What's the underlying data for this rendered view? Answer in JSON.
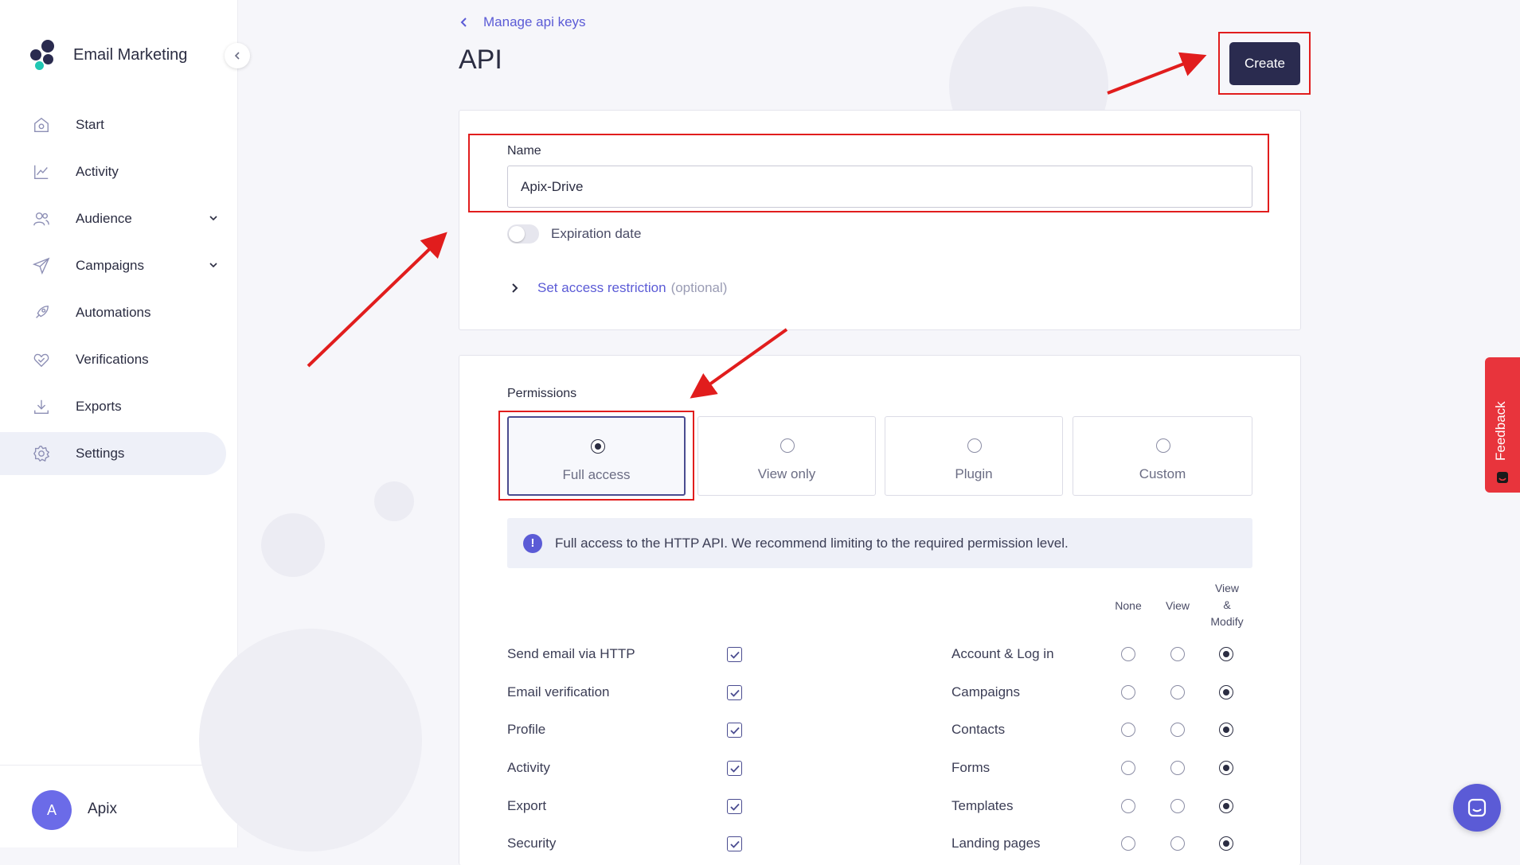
{
  "app": {
    "name": "Email Marketing"
  },
  "sidebar": {
    "items": [
      {
        "label": "Start",
        "icon": "home-icon"
      },
      {
        "label": "Activity",
        "icon": "chart-icon"
      },
      {
        "label": "Audience",
        "icon": "users-icon",
        "expandable": true
      },
      {
        "label": "Campaigns",
        "icon": "paper-plane-icon",
        "expandable": true
      },
      {
        "label": "Automations",
        "icon": "rocket-icon"
      },
      {
        "label": "Verifications",
        "icon": "heart-check-icon"
      },
      {
        "label": "Exports",
        "icon": "download-icon"
      },
      {
        "label": "Settings",
        "icon": "gear-icon",
        "active": true
      }
    ],
    "user": {
      "initial": "A",
      "name": "Apix"
    }
  },
  "header": {
    "back_label": "Manage api keys",
    "title": "API",
    "create_label": "Create"
  },
  "form": {
    "name_label": "Name",
    "name_value": "Apix-Drive",
    "expiration_label": "Expiration date",
    "expiration_enabled": false,
    "restriction_label": "Set access restriction",
    "restriction_optional": "(optional)"
  },
  "permissions": {
    "label": "Permissions",
    "options": [
      {
        "label": "Full access",
        "selected": true
      },
      {
        "label": "View only",
        "selected": false
      },
      {
        "label": "Plugin",
        "selected": false
      },
      {
        "label": "Custom",
        "selected": false
      }
    ],
    "info": "Full access to the HTTP API. We recommend limiting to the required permission level.",
    "columns": {
      "none": "None",
      "view": "View",
      "view_modify_1": "View",
      "view_modify_2": "&",
      "view_modify_3": "Modify"
    },
    "left_rows": [
      {
        "label": "Send email via HTTP",
        "checked": true
      },
      {
        "label": "Email verification",
        "checked": true
      },
      {
        "label": "Profile",
        "checked": true
      },
      {
        "label": "Activity",
        "checked": true
      },
      {
        "label": "Export",
        "checked": true
      },
      {
        "label": "Security",
        "checked": true
      }
    ],
    "right_rows": [
      {
        "label": "Account & Log in",
        "level": "View & Modify"
      },
      {
        "label": "Campaigns",
        "level": "View & Modify"
      },
      {
        "label": "Contacts",
        "level": "View & Modify"
      },
      {
        "label": "Forms",
        "level": "View & Modify"
      },
      {
        "label": "Templates",
        "level": "View & Modify"
      },
      {
        "label": "Landing pages",
        "level": "View & Modify"
      }
    ]
  },
  "feedback_label": "Feedback",
  "colors": {
    "accent": "#5b5bd6",
    "primary_button": "#2a2b4f",
    "annotation": "#e11d1d",
    "feedback": "#e8343c"
  }
}
